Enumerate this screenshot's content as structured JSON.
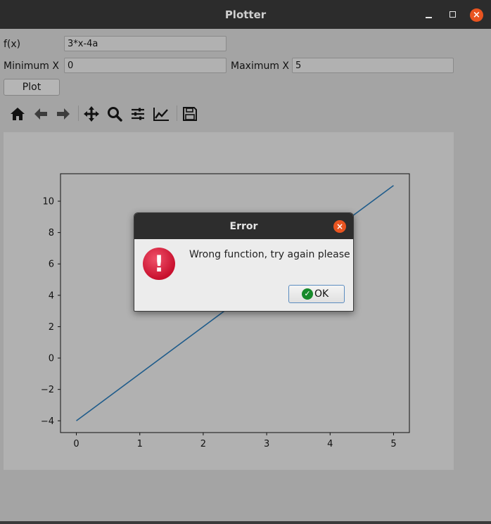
{
  "window": {
    "title": "Plotter",
    "close_glyph": "×"
  },
  "form": {
    "fx_label": "f(x)",
    "fx_value": "3*x-4a",
    "min_label": "Minimum X",
    "min_value": "0",
    "max_label": "Maximum X",
    "max_value": "5",
    "plot_label": "Plot"
  },
  "toolbar": {
    "icons": [
      "home-icon",
      "back-arrow-icon",
      "forward-arrow-icon",
      "pan-icon",
      "zoom-icon",
      "configure-subplots-icon",
      "edit-axes-icon",
      "save-icon"
    ]
  },
  "chart_data": {
    "type": "line",
    "x": [
      0,
      5
    ],
    "series": [
      {
        "values": [
          -4,
          11
        ],
        "color": "#1f5c8b"
      }
    ],
    "xlim": [
      -0.25,
      5.25
    ],
    "ylim": [
      -4.75,
      11.75
    ],
    "xticks": [
      "0",
      "1",
      "2",
      "3",
      "4",
      "5"
    ],
    "yticks": [
      "−4",
      "−2",
      "0",
      "2",
      "4",
      "6",
      "8",
      "10"
    ],
    "title": "",
    "xlabel": "",
    "ylabel": "",
    "grid": false
  },
  "dialog": {
    "title": "Error",
    "close_glyph": "×",
    "message": "Wrong function, try again please",
    "ok_label": "OK",
    "icon_glyph": "!",
    "ok_glyph": "✓",
    "accent": "#e95420",
    "error_color": "#d61a3c"
  }
}
